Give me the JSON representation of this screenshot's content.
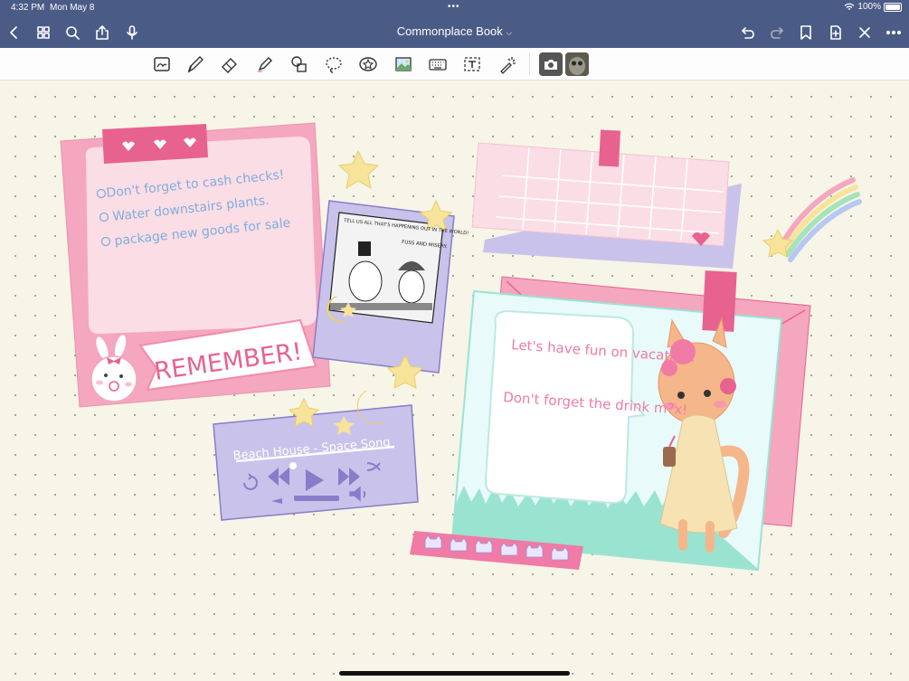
{
  "status": {
    "time": "4:32 PM",
    "date": "Mon May 8",
    "battery": "100%"
  },
  "nav": {
    "title": "Commonplace Book",
    "left_icons": [
      "back-chevron-icon",
      "grid-icon",
      "search-icon",
      "share-icon",
      "microphone-icon"
    ],
    "right_icons": [
      "undo-icon",
      "redo-icon",
      "bookmark-icon",
      "add-page-icon",
      "close-icon",
      "more-icon"
    ]
  },
  "toolbar": {
    "tools": [
      "lasso-image-tool",
      "pen-tool",
      "eraser-tool",
      "highlighter-tool",
      "shapes-tool",
      "lasso-tool",
      "sticker-tool",
      "image-tool",
      "keyboard-tool",
      "text-tool",
      "laser-pointer-tool",
      "camera-tool"
    ]
  },
  "remember_card": {
    "items": [
      "Don't forget to cash checks!",
      "Water downstairs plants.",
      "package new goods for sale"
    ],
    "banner": "REMEMBER!"
  },
  "comic": {
    "bubble_1": "TELL US ALL THAT'S HAPPENING OUT IN THE WORLD!",
    "bubble_2": "FUSS AND MISERY."
  },
  "music_player": {
    "track": "Beach House - Space Song"
  },
  "letter": {
    "line_1": "Let's have fun on vacation!",
    "line_2": "Don't forget the drink m?x!"
  },
  "colors": {
    "nav_bg": "#4a5b86",
    "canvas_bg": "#f6f5e7",
    "pink": "#f4a7bf",
    "lavender": "#c9c2ea"
  }
}
